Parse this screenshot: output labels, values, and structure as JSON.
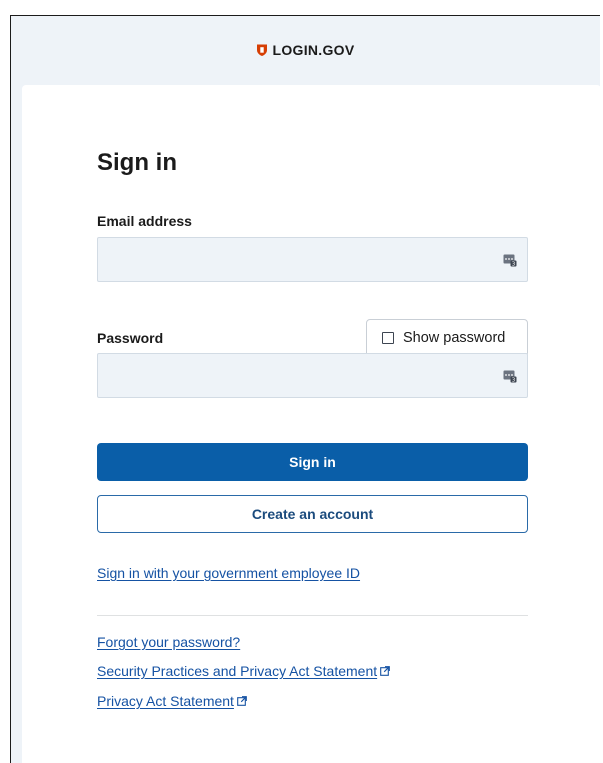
{
  "brand": {
    "name": "LOGIN.GOV",
    "accent_color": "#d63e04"
  },
  "form": {
    "title": "Sign in",
    "email": {
      "label": "Email address",
      "value": "",
      "placeholder": ""
    },
    "password": {
      "label": "Password",
      "value": "",
      "placeholder": ""
    },
    "show_password": {
      "label": "Show password",
      "checked": false
    },
    "primary_button": "Sign in",
    "secondary_button": "Create an account",
    "piv_link": "Sign in with your government employee ID"
  },
  "footer_links": [
    {
      "label": "Forgot your password?",
      "external": false
    },
    {
      "label": "Security Practices and Privacy Act Statement",
      "external": true
    },
    {
      "label": "Privacy Act Statement",
      "external": true
    }
  ],
  "colors": {
    "primary": "#0a5ea8",
    "link": "#1552a3",
    "field_bg": "#eef3f8",
    "page_bg": "#eef3f8"
  },
  "icons": {
    "brand": "shield-icon",
    "field_autofill": "password-manager-key-icon",
    "external_link": "external-link-icon"
  }
}
